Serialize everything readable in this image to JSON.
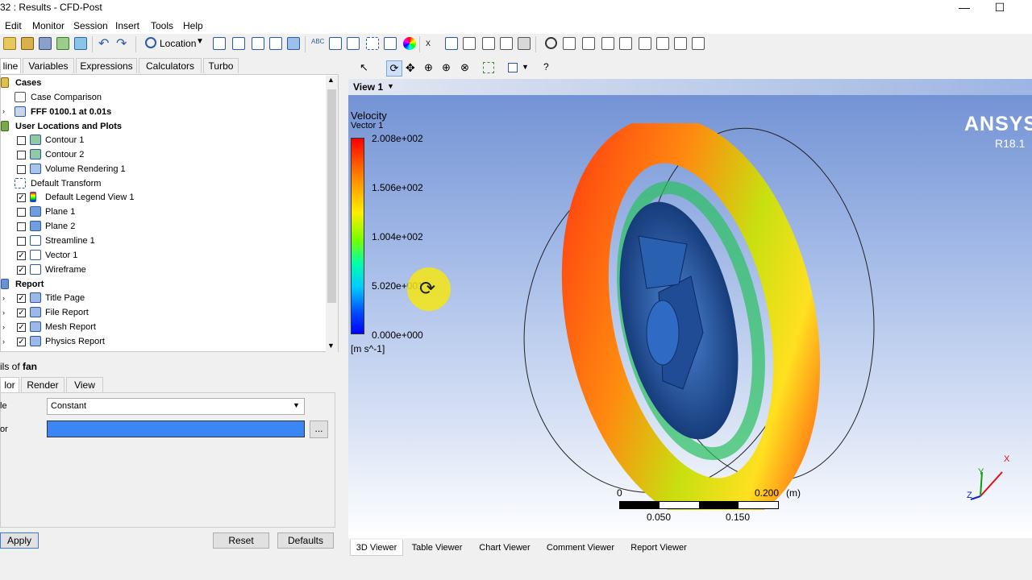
{
  "window": {
    "title": "32 : Results - CFD-Post",
    "minimize": "—",
    "maximize": "☐"
  },
  "menu": [
    "Edit",
    "Monitor",
    "Session",
    "Insert",
    "Tools",
    "Help"
  ],
  "toolbar": {
    "location_label": "Location"
  },
  "tree_tabs": [
    "line",
    "Variables",
    "Expressions",
    "Calculators",
    "Turbo"
  ],
  "tree": {
    "cases": "Cases",
    "case_comparison": "Case Comparison",
    "case_name": "FFF 0100.1 at 0.01s",
    "user_locations": "User Locations and Plots",
    "items": [
      {
        "label": "Contour 1",
        "checked": false
      },
      {
        "label": "Contour 2",
        "checked": false
      },
      {
        "label": "Volume Rendering 1",
        "checked": false
      },
      {
        "label": "Default Transform",
        "checked": null
      },
      {
        "label": "Default Legend View 1",
        "checked": true
      },
      {
        "label": "Plane 1",
        "checked": false
      },
      {
        "label": "Plane 2",
        "checked": false
      },
      {
        "label": "Streamline 1",
        "checked": false
      },
      {
        "label": "Vector 1",
        "checked": true
      },
      {
        "label": "Wireframe",
        "checked": true
      }
    ],
    "report": "Report",
    "report_items": [
      {
        "label": "Title Page",
        "checked": true
      },
      {
        "label": "File Report",
        "checked": true
      },
      {
        "label": "Mesh Report",
        "checked": true
      },
      {
        "label": "Physics Report",
        "checked": true
      }
    ]
  },
  "details": {
    "title_prefix": "ils of ",
    "title_object": "fan",
    "tabs": [
      "lor",
      "Render",
      "View"
    ],
    "mode_label": "le",
    "mode_value": "Constant",
    "color_label": "or",
    "color_value": "#3b86f5",
    "ellipsis": "...",
    "apply": "Apply",
    "reset": "Reset",
    "defaults": "Defaults"
  },
  "viewer": {
    "view_name": "View 1",
    "brand": "ANSYS",
    "version": "R18.1",
    "legend": {
      "title": "Velocity",
      "subtitle": "Vector 1",
      "ticks": [
        "2.008e+002",
        "1.506e+002",
        "1.004e+002",
        "5.020e+001",
        "0.000e+000"
      ],
      "unit": "[m s^-1]"
    },
    "scale": {
      "zero": "0",
      "max": "0.200",
      "unit": "(m)",
      "mid1": "0.050",
      "mid2": "0.150"
    },
    "axes": {
      "x": "X",
      "y": "Y",
      "z": "Z"
    }
  },
  "bottom_tabs": [
    "3D Viewer",
    "Table Viewer",
    "Chart Viewer",
    "Comment Viewer",
    "Report Viewer"
  ]
}
